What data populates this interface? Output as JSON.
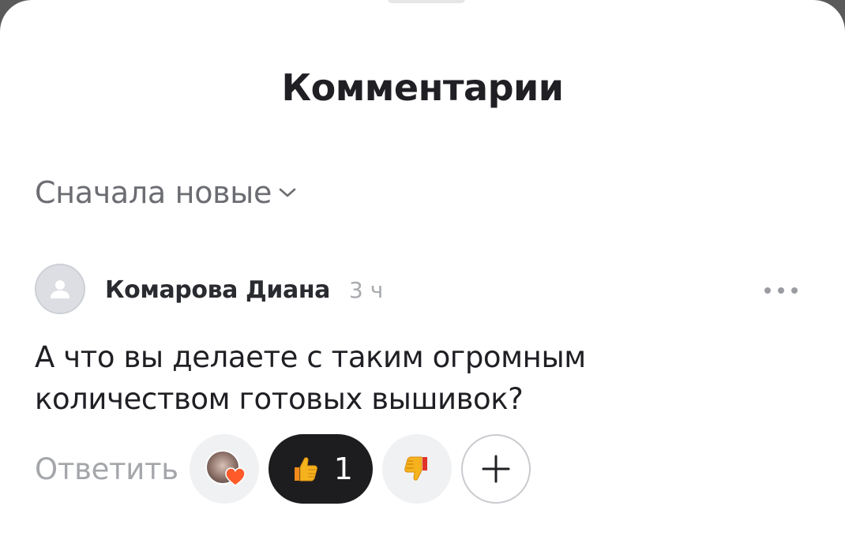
{
  "sheet": {
    "title": "Комментарии"
  },
  "sort": {
    "label": "Сначала новые"
  },
  "comment": {
    "author": "Комарова Диана",
    "time": "3 ч",
    "text": "А что вы делаете с таким огромным количеством готовых вышивок?",
    "reply_label": "Ответить",
    "reactions": {
      "like_count": "1"
    }
  },
  "icons": {
    "sort_chevron": "chevron-down-icon",
    "avatar": "user-placeholder-icon",
    "more": "more-dots-icon",
    "heart": "heart-icon",
    "like": "thumbs-up-icon",
    "dislike": "thumbs-down-icon",
    "add": "plus-icon"
  },
  "colors": {
    "like_pill_bg": "#1d1d1f",
    "heart": "#ff5a2a",
    "thumb": "#f5b21d"
  }
}
